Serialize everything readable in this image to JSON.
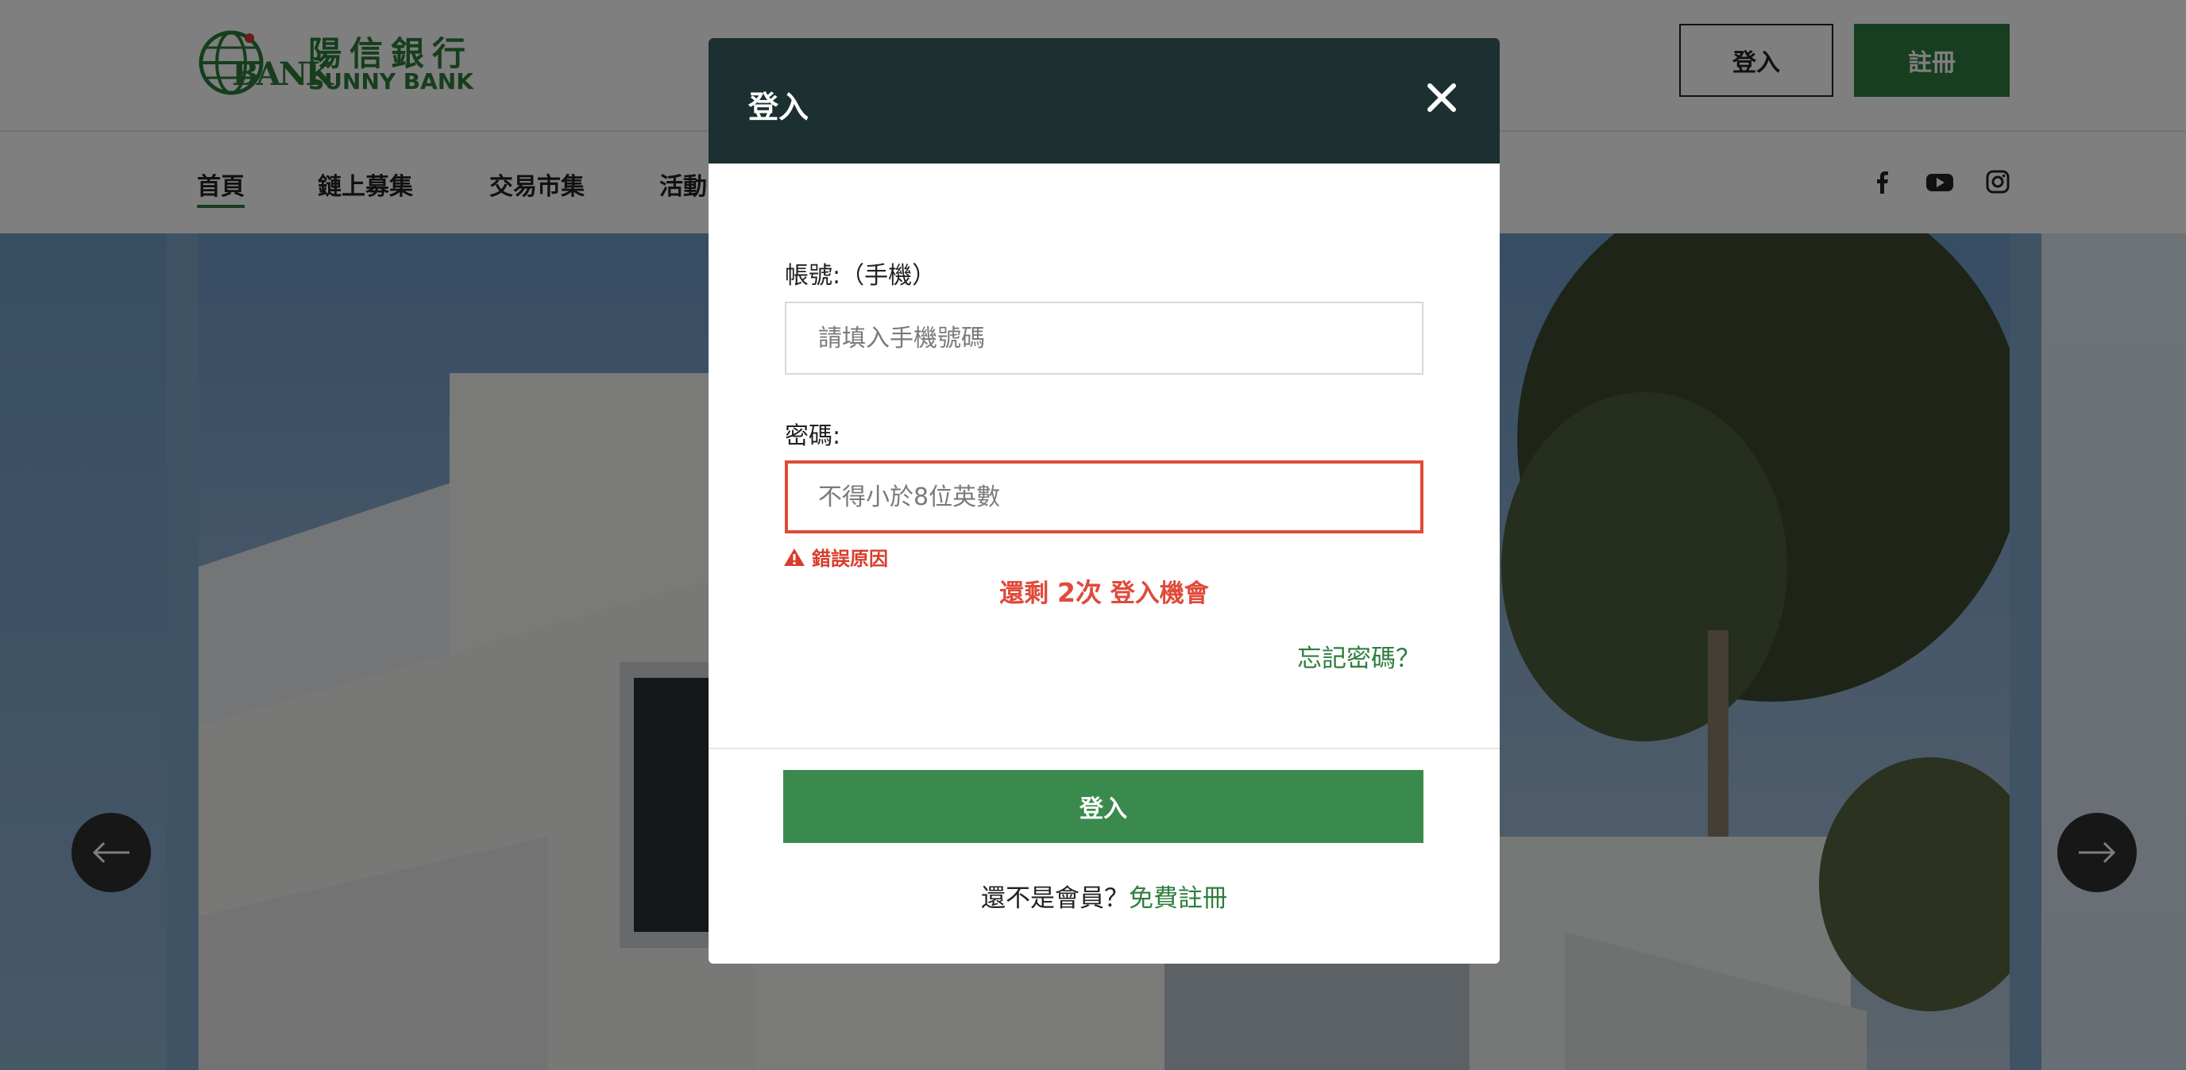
{
  "header": {
    "logo": {
      "bank_text": "BANK",
      "cn_name": "陽信銀行",
      "en_name": "SUNNY BANK",
      "brand_color": "#2d7d3a"
    },
    "login_label": "登入",
    "register_label": "註冊"
  },
  "nav": {
    "items": [
      {
        "label": "首頁",
        "active": true
      },
      {
        "label": "鏈上募集"
      },
      {
        "label": "交易市集"
      },
      {
        "label": "活動"
      }
    ],
    "social": [
      "facebook-icon",
      "youtube-icon",
      "instagram-icon"
    ]
  },
  "carousel": {
    "prev_icon": "arrow-left-icon",
    "next_icon": "arrow-right-icon"
  },
  "modal": {
    "title": "登入",
    "close_icon": "close-icon",
    "account": {
      "label": "帳號:（手機）",
      "placeholder": "請填入手機號碼",
      "value": ""
    },
    "password": {
      "label": "密碼:",
      "placeholder": "不得小於8位英數",
      "value": "",
      "state": "error"
    },
    "error_text": "錯誤原因",
    "attempts": {
      "prefix": "還剩 ",
      "count": "2次",
      "suffix": " 登入機會"
    },
    "forgot_link": "忘記密碼？",
    "submit_label": "登入",
    "signup_prompt": "還不是會員？",
    "signup_link": "免費註冊"
  },
  "colors": {
    "accent": "#2f7d3e",
    "modal_header": "#1c2f31",
    "error": "#e04a3a"
  }
}
